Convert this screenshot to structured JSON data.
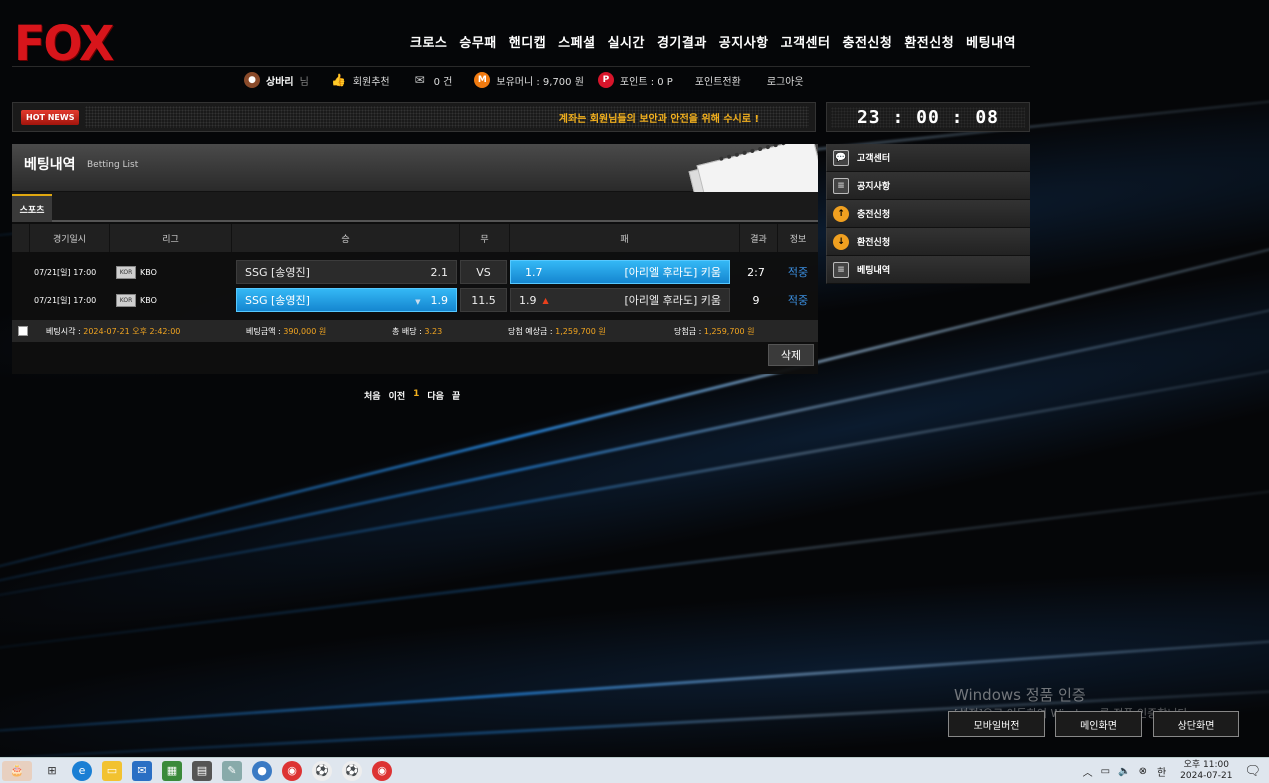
{
  "site": {
    "logo": "FOX"
  },
  "nav": [
    "크로스",
    "승무패",
    "핸디캡",
    "스페셜",
    "실시간",
    "경기결과",
    "공지사항",
    "고객센터",
    "충전신청",
    "환전신청",
    "베팅내역"
  ],
  "user": {
    "nickname": "상바리",
    "suffix": "님",
    "recommend": "회원추천",
    "messages": "0 건",
    "money": "보유머니 : 9,700 원",
    "points": "포인트 : 0 P",
    "point_convert": "포인트전환",
    "logout": "로그아웃"
  },
  "hotnews": {
    "badge": "HOT NEWS",
    "text": "계좌는 회원님들의 보안과 안전을 위해 수시로 !"
  },
  "clock": "23 : 00 : 08",
  "panel": {
    "title": "베팅내역",
    "subtitle": "Betting List",
    "tab": "스포츠",
    "columns": [
      "경기일시",
      "리그",
      "승",
      "무",
      "패",
      "결과",
      "정보"
    ],
    "rows": [
      {
        "date": "07/21[일] 17:00",
        "league": "KBO",
        "home": "SSG [송영진]",
        "home_odds": "2.1",
        "draw": "VS",
        "away_odds": "1.7",
        "away": "[아리엘 후라도] 키움",
        "result": "2:7",
        "info": "적중",
        "selected": "away"
      },
      {
        "date": "07/21[일] 17:00",
        "league": "KBO",
        "home": "SSG [송영진]",
        "home_odds": "1.9",
        "draw": "11.5",
        "away_odds": "1.9",
        "away": "[아리엘 후라도] 키움",
        "result": "9",
        "info": "적중",
        "selected": "home"
      }
    ],
    "summary": {
      "bet_time_label": "베팅시각 : ",
      "bet_time": "2024-07-21 오후 2:42:00",
      "bet_amount_label": "베팅금액 : ",
      "bet_amount": "390,000 원",
      "total_odds_label": "총 배당 : ",
      "total_odds": "3.23",
      "expected_label": "당첨 예상금 : ",
      "expected": "1,259,700 원",
      "won_label": "당첨금 : ",
      "won": "1,259,700 원"
    },
    "delete": "삭제"
  },
  "pager": {
    "first": "처음",
    "prev": "이전",
    "current": "1",
    "next": "다음",
    "last": "끝"
  },
  "side_menu": [
    "고객센터",
    "공지사항",
    "충전신청",
    "환전신청",
    "베팅내역"
  ],
  "watermark": {
    "line1": "Windows 정품 인증",
    "line2": "[설정]으로 이동하여 Windows를 정품 인증합니다."
  },
  "bottom_buttons": [
    "모바일버전",
    "메인화면",
    "상단화면"
  ],
  "taskbar": {
    "time": "오후 11:00",
    "date": "2024-07-21",
    "ime": "한"
  },
  "colors": {
    "logo": "#d8151b",
    "accent": "#f2b01e",
    "selected": "#1a9fe8",
    "info": "#3b8fe0"
  }
}
